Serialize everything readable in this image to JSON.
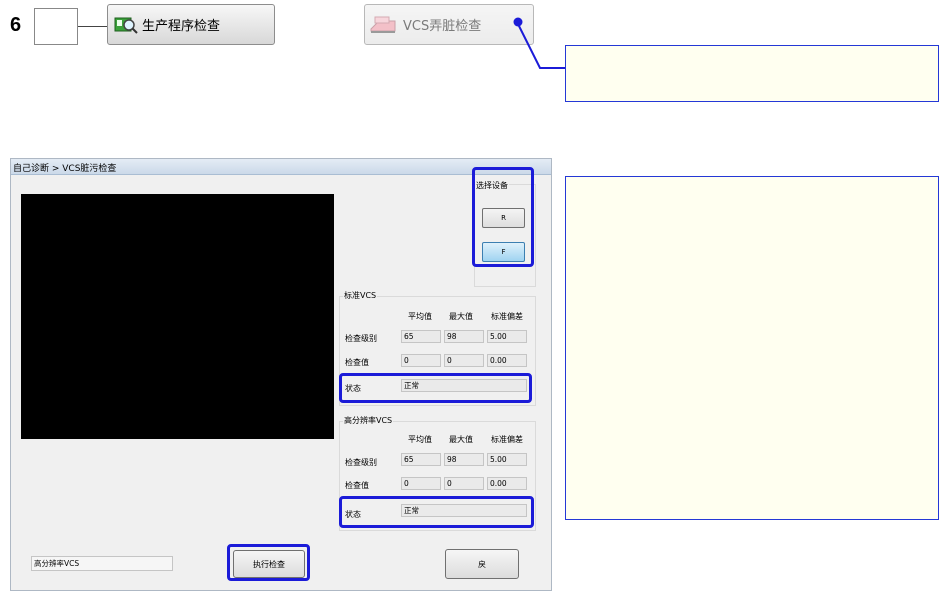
{
  "step": {
    "number": "6"
  },
  "buttons": {
    "production_check": "生产程序检查",
    "vcs_dirty_check": "VCS弄脏检查"
  },
  "dialog": {
    "breadcrumb": "自己诊断 > VCS脏污检查",
    "select_device": {
      "title": "选择设备",
      "options": [
        "R",
        "F"
      ],
      "selected": "F"
    },
    "standard_vcs": {
      "title": "标准VCS",
      "headers": [
        "平均值",
        "最大值",
        "标准偏差"
      ],
      "rows": [
        {
          "label": "检查级别",
          "values": [
            "65",
            "98",
            "5.00"
          ]
        },
        {
          "label": "检查值",
          "values": [
            "0",
            "0",
            "0.00"
          ]
        }
      ],
      "status_label": "状态",
      "status_value": "正常"
    },
    "hires_vcs": {
      "title": "高分辨率VCS",
      "headers": [
        "平均值",
        "最大值",
        "标准偏差"
      ],
      "rows": [
        {
          "label": "检查级别",
          "values": [
            "65",
            "98",
            "5.00"
          ]
        },
        {
          "label": "检查值",
          "values": [
            "0",
            "0",
            "0.00"
          ]
        }
      ],
      "status_label": "状态",
      "status_value": "正常"
    },
    "mode_field": "高分辨率VCS",
    "execute_button": "执行检查",
    "return_button": "戻"
  },
  "colors": {
    "highlight": "#1b1bd8",
    "note_background": "#fffff0",
    "note_border": "#2438d6"
  }
}
